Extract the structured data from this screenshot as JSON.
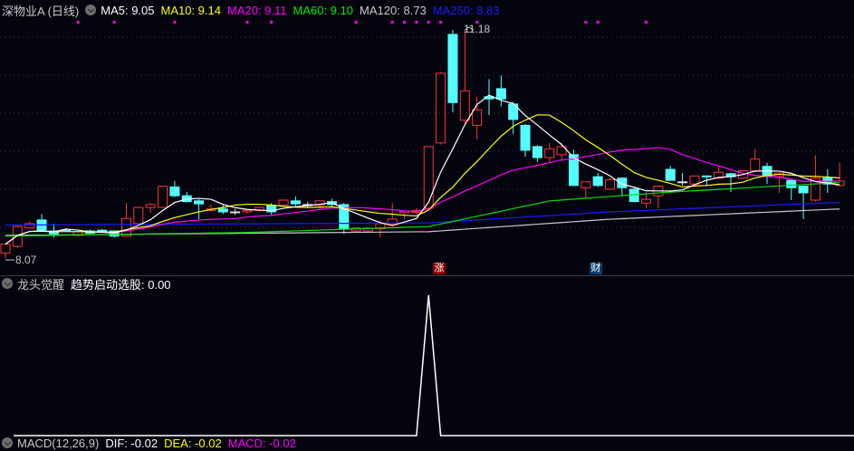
{
  "header": {
    "title": "深物业A (日线)",
    "ma": [
      {
        "label": "MA5: 9.05",
        "color": "#ffffff"
      },
      {
        "label": "MA10: 9.14",
        "color": "#ffff00"
      },
      {
        "label": "MA20: 9.11",
        "color": "#ff00ff"
      },
      {
        "label": "MA60: 9.10",
        "color": "#00e000"
      },
      {
        "label": "MA120: 8.73",
        "color": "#c8c8c8"
      },
      {
        "label": "MA250: 8.83",
        "color": "#1a1aff"
      }
    ]
  },
  "price_labels": {
    "high": "11.18",
    "low": "8.07"
  },
  "markers": [
    {
      "text": "涨",
      "index": 36,
      "color": "#8b0000"
    },
    {
      "text": "财",
      "index": 49,
      "color": "#0b3d6e"
    }
  ],
  "indicator": {
    "name": "龙头觉醒",
    "label": "趋势启动选股: 0.00",
    "spike_index": 35
  },
  "macd": {
    "name": "MACD(12,26,9)",
    "dif": "DIF: -0.02",
    "dea": "DEA: -0.02",
    "macd": "MACD: -0.02"
  },
  "colors": {
    "up": "#ff3333",
    "down": "#54ffff",
    "bg": "#04040e",
    "signal_dot": "#ff00ff"
  },
  "chart_data": {
    "type": "candlestick",
    "ohlc": [
      [
        8.14,
        8.26,
        8.07,
        8.26
      ],
      [
        8.23,
        8.52,
        8.21,
        8.5
      ],
      [
        8.48,
        8.57,
        8.47,
        8.54
      ],
      [
        8.59,
        8.67,
        8.45,
        8.45
      ],
      [
        8.44,
        8.54,
        8.35,
        8.4
      ],
      [
        8.45,
        8.48,
        8.43,
        8.44
      ],
      [
        8.38,
        8.45,
        8.36,
        8.43
      ],
      [
        8.44,
        8.46,
        8.4,
        8.41
      ],
      [
        8.45,
        8.47,
        8.42,
        8.43
      ],
      [
        8.44,
        8.45,
        8.35,
        8.37
      ],
      [
        8.37,
        8.82,
        8.36,
        8.61
      ],
      [
        8.54,
        8.77,
        8.52,
        8.76
      ],
      [
        8.76,
        8.82,
        8.69,
        8.8
      ],
      [
        8.76,
        9.05,
        8.75,
        9.05
      ],
      [
        9.04,
        9.12,
        8.9,
        8.92
      ],
      [
        8.92,
        8.97,
        8.83,
        8.84
      ],
      [
        8.85,
        8.87,
        8.6,
        8.81
      ],
      [
        8.72,
        8.8,
        8.7,
        8.74
      ],
      [
        8.74,
        8.8,
        8.67,
        8.7
      ],
      [
        8.7,
        8.74,
        8.66,
        8.7
      ],
      [
        8.7,
        8.74,
        8.68,
        8.72
      ],
      [
        8.72,
        8.77,
        8.7,
        8.76
      ],
      [
        8.79,
        8.82,
        8.66,
        8.7
      ],
      [
        8.79,
        8.87,
        8.78,
        8.86
      ],
      [
        8.85,
        8.91,
        8.78,
        8.81
      ],
      [
        8.8,
        8.84,
        8.76,
        8.8
      ],
      [
        8.79,
        8.86,
        8.74,
        8.85
      ],
      [
        8.84,
        8.88,
        8.78,
        8.8
      ],
      [
        8.8,
        8.82,
        8.4,
        8.47
      ],
      [
        8.44,
        8.49,
        8.42,
        8.48
      ],
      [
        8.44,
        8.49,
        8.42,
        8.48
      ],
      [
        8.47,
        8.58,
        8.35,
        8.54
      ],
      [
        8.53,
        8.82,
        8.51,
        8.6
      ],
      [
        8.69,
        8.72,
        8.6,
        8.71
      ],
      [
        8.69,
        8.75,
        8.66,
        8.72
      ],
      [
        8.75,
        9.59,
        8.74,
        9.59
      ],
      [
        9.64,
        10.61,
        9.62,
        10.59
      ],
      [
        11.12,
        11.18,
        10.06,
        10.19
      ],
      [
        9.95,
        11.18,
        9.9,
        10.35
      ],
      [
        9.88,
        10.27,
        9.69,
        10.09
      ],
      [
        10.27,
        10.51,
        10.02,
        10.24
      ],
      [
        10.38,
        10.56,
        10.14,
        10.24
      ],
      [
        10.17,
        10.2,
        9.76,
        9.96
      ],
      [
        9.88,
        9.9,
        9.45,
        9.54
      ],
      [
        9.59,
        9.61,
        9.38,
        9.44
      ],
      [
        9.44,
        9.64,
        9.38,
        9.56
      ],
      [
        9.48,
        9.64,
        9.39,
        9.59
      ],
      [
        9.48,
        9.55,
        9.06,
        9.06
      ],
      [
        9.03,
        9.11,
        8.88,
        9.11
      ],
      [
        9.18,
        9.23,
        9.04,
        9.06
      ],
      [
        9.01,
        9.16,
        9.0,
        9.14
      ],
      [
        9.16,
        9.17,
        8.91,
        9.03
      ],
      [
        9.01,
        9.03,
        8.84,
        8.84
      ],
      [
        8.82,
        8.97,
        8.75,
        8.87
      ],
      [
        8.92,
        9.06,
        8.75,
        9.05
      ],
      [
        9.28,
        9.33,
        9.13,
        9.13
      ],
      [
        9.11,
        9.23,
        9.06,
        9.11
      ],
      [
        9.08,
        9.19,
        9.07,
        9.19
      ],
      [
        9.19,
        9.2,
        9.05,
        9.18
      ],
      [
        9.16,
        9.33,
        9.15,
        9.24
      ],
      [
        9.22,
        9.23,
        8.97,
        9.18
      ],
      [
        9.16,
        9.26,
        9.15,
        9.26
      ],
      [
        9.26,
        9.56,
        9.24,
        9.42
      ],
      [
        9.32,
        9.37,
        9.08,
        9.19
      ],
      [
        9.18,
        9.22,
        8.96,
        9.23
      ],
      [
        9.13,
        9.15,
        8.86,
        9.03
      ],
      [
        9.05,
        9.06,
        8.6,
        8.96
      ],
      [
        8.86,
        9.47,
        8.84,
        9.16
      ],
      [
        9.16,
        9.28,
        8.96,
        9.08
      ],
      [
        9.06,
        9.37,
        9.05,
        9.12
      ]
    ],
    "ma60": [
      [
        0,
        8.37
      ],
      [
        20,
        8.42
      ],
      [
        35,
        8.5
      ],
      [
        45,
        8.85
      ],
      [
        55,
        8.97
      ],
      [
        69,
        9.1
      ]
    ],
    "ma120": [
      [
        0,
        8.38
      ],
      [
        35,
        8.43
      ],
      [
        50,
        8.6
      ],
      [
        69,
        8.74
      ]
    ],
    "ma250": [
      [
        0,
        8.52
      ],
      [
        35,
        8.55
      ],
      [
        50,
        8.7
      ],
      [
        69,
        8.83
      ]
    ],
    "signal_dots": [
      6,
      9,
      14,
      20,
      22,
      29,
      32,
      33,
      34,
      35,
      36,
      39,
      48,
      49,
      53
    ],
    "price_range": [
      8.07,
      11.18
    ]
  }
}
